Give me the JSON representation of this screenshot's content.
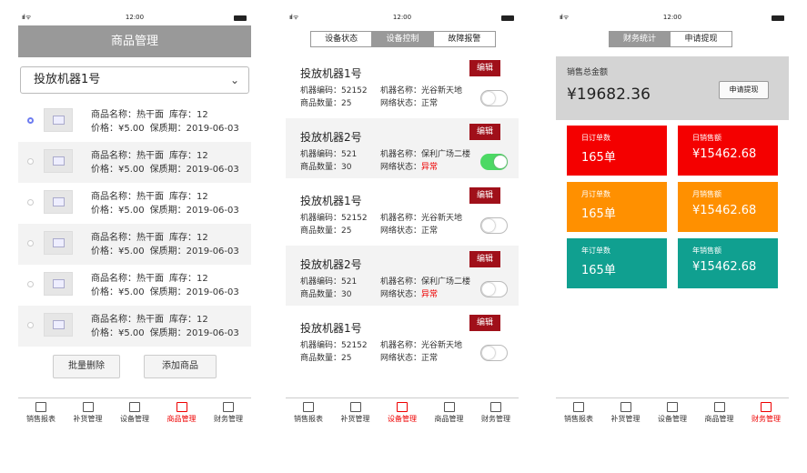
{
  "status": {
    "time": "12:00",
    "signal": "ııl ᯤ"
  },
  "tabs": [
    "销售报表",
    "补货管理",
    "设备管理",
    "商品管理",
    "财务管理"
  ],
  "screen1": {
    "title": "商品管理",
    "dropdown_value": "投放机器1号",
    "products": [
      {
        "name_line": "商品名称：热干面",
        "stock": "库存：12",
        "price": "价格：¥5.00",
        "expiry": "保质期：2019-06-03",
        "selected": true
      },
      {
        "name_line": "商品名称：热干面",
        "stock": "库存：12",
        "price": "价格：¥5.00",
        "expiry": "保质期：2019-06-03",
        "selected": false
      },
      {
        "name_line": "商品名称：热干面",
        "stock": "库存：12",
        "price": "价格：¥5.00",
        "expiry": "保质期：2019-06-03",
        "selected": false
      },
      {
        "name_line": "商品名称：热干面",
        "stock": "库存：12",
        "price": "价格：¥5.00",
        "expiry": "保质期：2019-06-03",
        "selected": false
      },
      {
        "name_line": "商品名称：热干面",
        "stock": "库存：12",
        "price": "价格：¥5.00",
        "expiry": "保质期：2019-06-03",
        "selected": false
      },
      {
        "name_line": "商品名称：热干面",
        "stock": "库存：12",
        "price": "价格：¥5.00",
        "expiry": "保质期：2019-06-03",
        "selected": false
      }
    ],
    "batch_delete": "批量删除",
    "add_product": "添加商品",
    "active_tab": "商品管理"
  },
  "screen2": {
    "segments": [
      "设备状态",
      "设备控制",
      "故障报警"
    ],
    "active_segment": "设备控制",
    "edit_label": "编辑",
    "devices": [
      {
        "name": "投放机器1号",
        "code": "机器编码：52152",
        "place": "机器名称：光谷新天地",
        "count": "商品数量：25",
        "net_label": "网络状态：",
        "net": "正常",
        "abnormal": false,
        "on": false
      },
      {
        "name": "投放机器2号",
        "code": "机器编码：521",
        "place": "机器名称：保利广场二楼",
        "count": "商品数量：30",
        "net_label": "网络状态：",
        "net": "异常",
        "abnormal": true,
        "on": true
      },
      {
        "name": "投放机器1号",
        "code": "机器编码：52152",
        "place": "机器名称：光谷新天地",
        "count": "商品数量：25",
        "net_label": "网络状态：",
        "net": "正常",
        "abnormal": false,
        "on": false
      },
      {
        "name": "投放机器2号",
        "code": "机器编码：521",
        "place": "机器名称：保利广场二楼",
        "count": "商品数量：30",
        "net_label": "网络状态：",
        "net": "异常",
        "abnormal": true,
        "on": false
      },
      {
        "name": "投放机器1号",
        "code": "机器编码：52152",
        "place": "机器名称：光谷新天地",
        "count": "商品数量：25",
        "net_label": "网络状态：",
        "net": "正常",
        "abnormal": false,
        "on": false
      }
    ],
    "active_tab": "设备管理"
  },
  "screen3": {
    "segments": [
      "财务统计",
      "申请提现"
    ],
    "active_segment": "财务统计",
    "total_label": "销售总金额",
    "total_amount": "¥19682.36",
    "withdraw": "申请提现",
    "cards": [
      {
        "label": "日订单数",
        "value": "165单",
        "color": "#f40000"
      },
      {
        "label": "日销售额",
        "value": "¥15462.68",
        "color": "#f40000"
      },
      {
        "label": "月订单数",
        "value": "165单",
        "color": "#ff9000"
      },
      {
        "label": "月销售额",
        "value": "¥15462.68",
        "color": "#ff9000"
      },
      {
        "label": "年订单数",
        "value": "165单",
        "color": "#10a090"
      },
      {
        "label": "年销售额",
        "value": "¥15462.68",
        "color": "#10a090"
      }
    ],
    "active_tab": "财务管理"
  }
}
